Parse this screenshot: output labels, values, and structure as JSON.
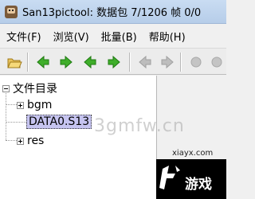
{
  "window": {
    "title": "San13pictool:  数据包 7/1206  帧 0/0"
  },
  "menu": [
    "文件(F)",
    "浏览(V)",
    "批量(B)",
    "帮助(H)"
  ],
  "toolbar": {
    "buttons": [
      "open-folder-icon",
      "first-icon",
      "next-icon",
      "prev-icon",
      "last-icon",
      "back-icon-disabled",
      "forward-icon-disabled",
      "tool-icon-disabled",
      "tool2-icon-disabled"
    ]
  },
  "tree": {
    "root": "文件目录",
    "children": [
      {
        "label": "bgm",
        "expander": "+"
      },
      {
        "label": "DATA0.S13",
        "selected": true
      },
      {
        "label": "res",
        "expander": "+"
      }
    ]
  },
  "watermarks": {
    "center": "3gmfw.cn",
    "site": "xiayx.com",
    "brand": "游戏"
  },
  "colors": {
    "selection": "#c6c4f0",
    "arrow_green": "#3fae2a",
    "titlebar": "#c9dcf2"
  }
}
